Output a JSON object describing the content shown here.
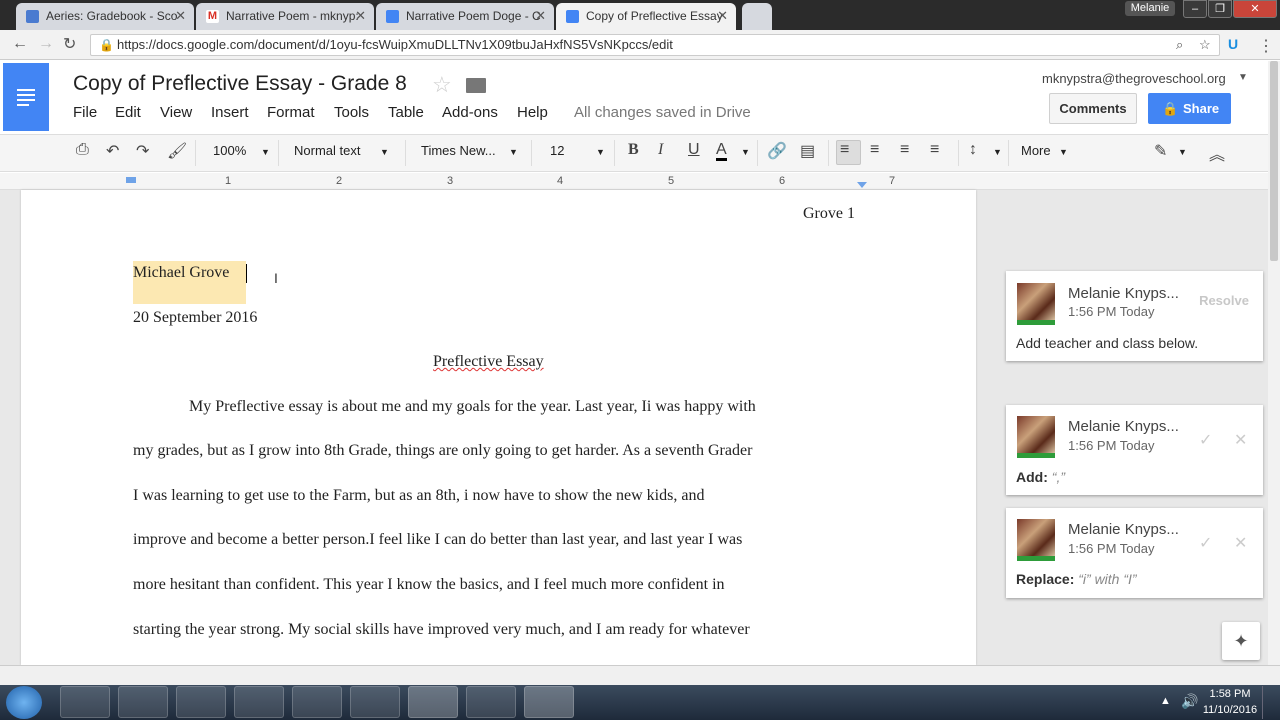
{
  "tabs": [
    {
      "title": "Aeries: Gradebook - Sco",
      "color": "#4a7bd0"
    },
    {
      "title": "Narrative Poem - mknyp:",
      "color": "#d93025"
    },
    {
      "title": "Narrative Poem Doge - C",
      "color": "#4285f4"
    },
    {
      "title": "Copy of Preflective Essay",
      "color": "#4285f4",
      "active": true
    }
  ],
  "window": {
    "user": "Melanie",
    "minimize": "–",
    "restore": "❐",
    "close": "✕"
  },
  "address": {
    "url": "https://docs.google.com/document/d/1oyu-fcsWuipXmuDLLTNv1X09tbuJaHxfNS5VsNKpccs/edit"
  },
  "doc": {
    "title": "Copy of Preflective Essay - Grade 8",
    "menu": [
      "File",
      "Edit",
      "View",
      "Insert",
      "Format",
      "Tools",
      "Table",
      "Add-ons",
      "Help"
    ],
    "saved": "All changes saved in Drive",
    "account": "mknypstra@thegroveschool.org",
    "comments_label": "Comments",
    "share_label": "Share"
  },
  "toolbar": {
    "zoom": "100%",
    "style": "Normal text",
    "font": "Times New...",
    "size": "12",
    "more": "More"
  },
  "ruler": [
    "1",
    "2",
    "3",
    "4",
    "5",
    "6",
    "7"
  ],
  "page": {
    "header": "Grove 1",
    "name": "Michael Grove",
    "date": "20 September 2016",
    "title": "Preflective Essay",
    "lines": [
      "My Preflective essay is about me and my goals for the year. Last year, Ii was happy with",
      "my grades, but as I grow into 8th Grade, things are only going to get harder. As a seventh Grader",
      "I was learning to get use to the Farm, but as an 8th, i now have to show the new kids, and",
      "improve and become a better person.I feel like I can do better than last year, and last year I was",
      "more hesitant than confident. This year I know the basics,  and I feel much more confident in",
      "starting the year strong. My social skills have improved very much, and I am ready for whatever"
    ]
  },
  "comments": [
    {
      "author": "Melanie Knyps...",
      "time": "1:56 PM Today",
      "action": "Resolve",
      "text": "Add teacher and class below."
    },
    {
      "author": "Melanie Knyps...",
      "time": "1:56 PM Today",
      "label": "Add:",
      "detail": "“,”"
    },
    {
      "author": "Melanie Knyps...",
      "time": "1:56 PM Today",
      "label": "Replace:",
      "detail": "“i” with “I”"
    }
  ],
  "clock": {
    "time": "1:58 PM",
    "date": "11/10/2016"
  },
  "colors": {
    "accent": "#4285f4",
    "highlight": "#fce8b2"
  }
}
